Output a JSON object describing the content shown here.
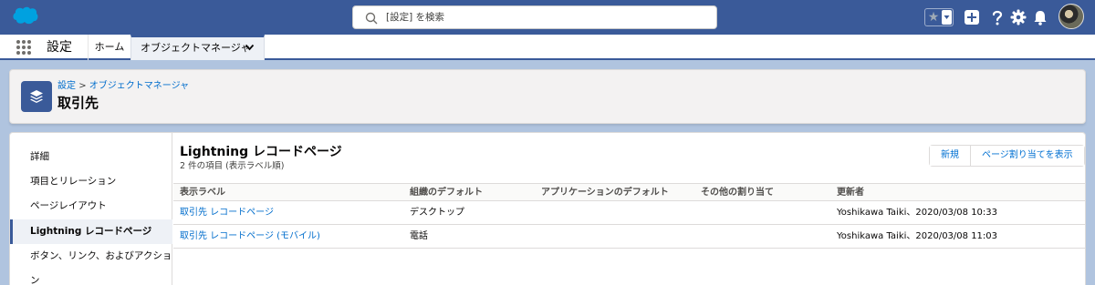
{
  "header": {
    "search_placeholder": "[設定] を検索",
    "brand_color": "#3a5a99"
  },
  "app_nav": {
    "app_name": "設定",
    "tabs": [
      {
        "label": "ホーム"
      },
      {
        "label": "オブジェクトマネージャ"
      }
    ]
  },
  "page_header": {
    "breadcrumb": {
      "root": "設定",
      "separator": ">",
      "current": "オブジェクトマネージャ"
    },
    "title": "取引先"
  },
  "sidebar": {
    "items": [
      {
        "label": "詳細"
      },
      {
        "label": "項目とリレーション"
      },
      {
        "label": "ページレイアウト"
      },
      {
        "label": "Lightning レコードページ"
      },
      {
        "label": "ボタン、リンク、およびアクション"
      }
    ],
    "active_index": 3
  },
  "main": {
    "section_title": "Lightning レコードページ",
    "section_subtitle": "2 件の項目 (表示ラベル順)",
    "buttons": {
      "new": "新規",
      "assign": "ページ割り当てを表示"
    },
    "table": {
      "columns": [
        "表示ラベル",
        "組織のデフォルト",
        "アプリケーションのデフォルト",
        "その他の割り当て",
        "更新者"
      ],
      "rows": [
        {
          "label": "取引先 レコードページ",
          "org_default": "デスクトップ",
          "app_default": "",
          "other": "",
          "modified_by": "Yoshikawa Taiki、2020/03/08 10:33"
        },
        {
          "label": "取引先 レコードページ (モバイル)",
          "org_default": "電話",
          "app_default": "",
          "other": "",
          "modified_by": "Yoshikawa Taiki、2020/03/08 11:03"
        }
      ]
    }
  }
}
